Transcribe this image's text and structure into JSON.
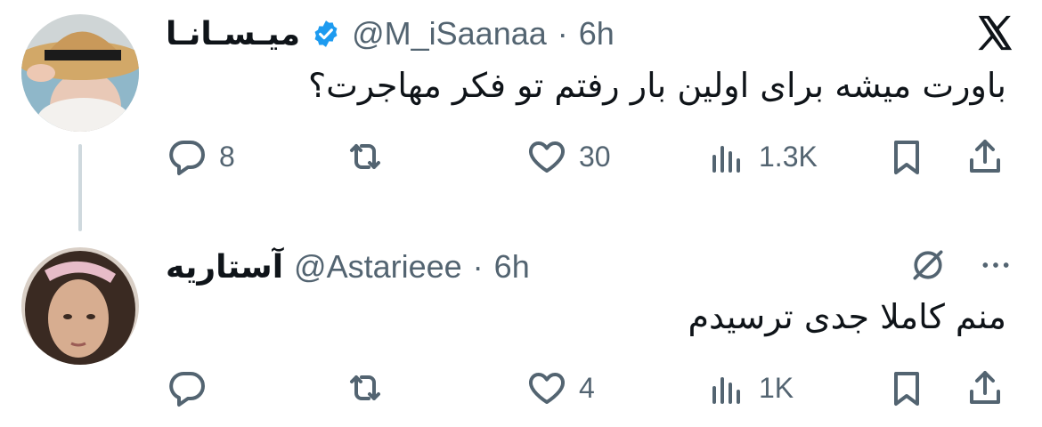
{
  "tweets": [
    {
      "name": "میـسـانـا",
      "handle": "@M_iSaanaa",
      "separator": "·",
      "time": "6h",
      "text": "باورت میشه برای اولین بار رفتم تو فکر مهاجرت؟",
      "replies": "8",
      "retweets": "",
      "likes": "30",
      "views": "1.3K",
      "verified": true
    },
    {
      "name": "آستاریه",
      "handle": "@Astarieee",
      "separator": "·",
      "time": "6h",
      "text": "منم کاملا جدی ترسیدم",
      "replies": "",
      "retweets": "",
      "likes": "4",
      "views": "1K",
      "verified": false
    }
  ],
  "colors": {
    "icon": "#536471",
    "verified": "#1d9bf0",
    "thread_line": "#cfd9de",
    "text": "#0f1419"
  },
  "icons": [
    "x-logo-icon",
    "grok-icon",
    "more-icon",
    "reply-icon",
    "retweet-icon",
    "like-icon",
    "views-icon",
    "bookmark-icon",
    "share-icon",
    "verified-badge-icon"
  ]
}
